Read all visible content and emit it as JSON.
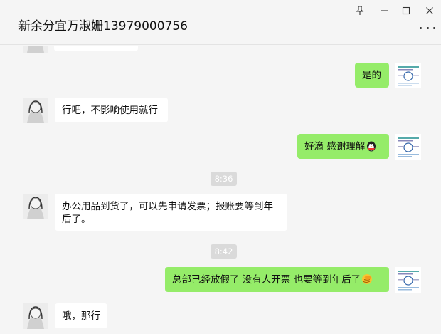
{
  "window": {
    "title": "新余分宜万淑姗13979000756",
    "pin_icon": "pin-icon",
    "minimize_icon": "minimize-icon",
    "maximize_icon": "maximize-icon",
    "close_icon": "close-icon",
    "more_icon": "more-options-icon"
  },
  "messages": [
    {
      "side": "out",
      "text": "是的"
    },
    {
      "side": "in",
      "text": "行吧，不影响使用就行"
    },
    {
      "side": "out",
      "text": "好滴 感谢理解",
      "emoji": "penguin-emoji"
    },
    {
      "time": "8:36"
    },
    {
      "side": "in",
      "line1": "办公用品到货了，可以先申请发票；报账要等到年",
      "line2": "后了。"
    },
    {
      "time": "8:42"
    },
    {
      "side": "out",
      "text": "总部已经放假了 没有人开票 也要等到年后了",
      "emoji": "facepalm-emoji"
    },
    {
      "side": "in",
      "text": "哦，那行"
    }
  ],
  "colors": {
    "outgoing_bubble": "#95ec69",
    "incoming_bubble": "#ffffff",
    "background": "#f5f5f5",
    "timestamp_bg": "#dadada"
  }
}
